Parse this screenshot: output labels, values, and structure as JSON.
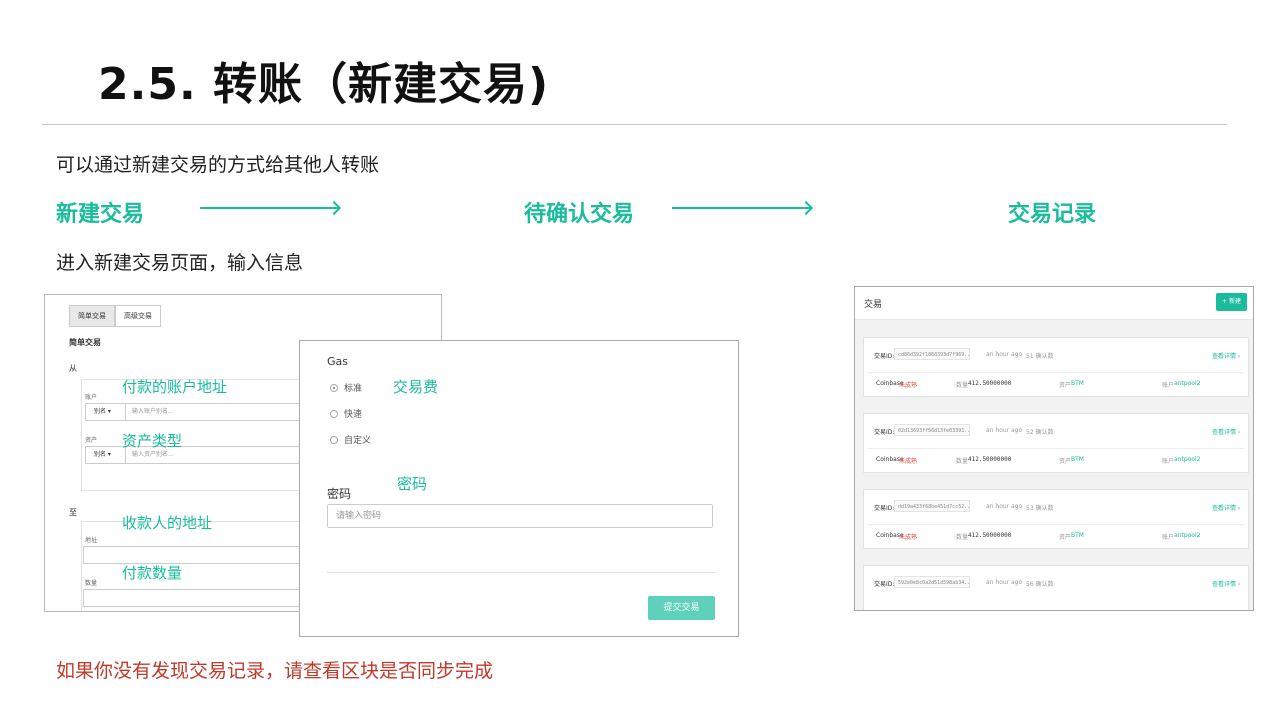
{
  "slide": {
    "title": "2.5. 转账（新建交易)",
    "intro": "可以通过新建交易的方式给其他人转账",
    "steps": [
      "新建交易",
      "待确认交易",
      "交易记录"
    ],
    "subtitle": "进入新建交易页面，输入信息",
    "warning": "如果你没有发现交易记录，请查看区块是否同步完成"
  },
  "annotations": {
    "pay_address": "付款的账户地址",
    "asset_type": "资产类型",
    "receiver_address": "收款人的地址",
    "pay_amount": "付款数量",
    "fee": "交易费",
    "password": "密码"
  },
  "form": {
    "tab_simple": "简单交易",
    "tab_advanced": "高级交易",
    "section_title": "简单交易",
    "from_label": "从",
    "account_label": "账户",
    "alias_dropdown": "别名 ▾",
    "account_placeholder": "输入账户别名...",
    "asset_label": "资产",
    "asset_placeholder": "输入资产别名...",
    "to_label": "至",
    "address_label": "地址",
    "amount_label": "数量"
  },
  "gas_panel": {
    "title": "Gas",
    "options": [
      "标准",
      "快速",
      "自定义"
    ],
    "password_label": "密码",
    "password_placeholder": "请输入密码",
    "submit_label": "提交交易"
  },
  "tx_list": {
    "title": "交易",
    "new_button": "+ 新建",
    "id_label": "交易ID:",
    "detail_link": "查看详情 ›",
    "coinbase": "Coinbase",
    "status": "未成熟",
    "amount_label": "数量",
    "asset_label": "资产",
    "account_label": "账户",
    "items": [
      {
        "hash": "cd86d392f1868393d7f969...",
        "time": "an hour ago",
        "confirm": "51 确认数",
        "amount": "412.50000000",
        "asset": "BTM",
        "account": "antpool2"
      },
      {
        "hash": "02d13693ff56d13fe03391...",
        "time": "an hour ago",
        "confirm": "52 确认数",
        "amount": "412.50000000",
        "asset": "BTM",
        "account": "antpool2"
      },
      {
        "hash": "dd19a433f68be451d7cc52...",
        "time": "an hour ago",
        "confirm": "53 确认数",
        "amount": "412.50000000",
        "asset": "BTM",
        "account": "antpool2"
      },
      {
        "hash": "592e0e8c0a2d51d598ab34...",
        "time": "an hour ago",
        "confirm": "56 确认数"
      }
    ]
  },
  "colors": {
    "accent": "#1abc9c",
    "warning": "#c0392b"
  }
}
